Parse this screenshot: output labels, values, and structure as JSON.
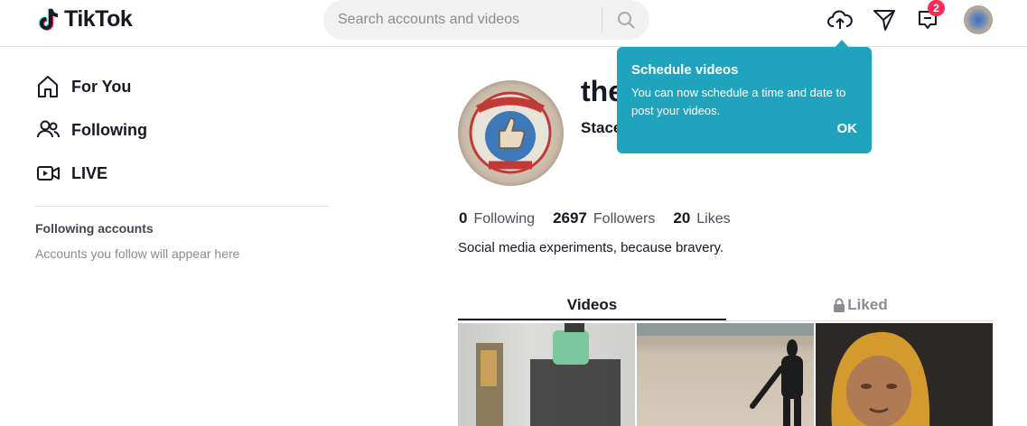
{
  "header": {
    "logo_text": "TikTok",
    "search_placeholder": "Search accounts and videos",
    "inbox_badge": "2",
    "icons": [
      "upload-icon",
      "messages-icon",
      "inbox-icon",
      "search-icon"
    ]
  },
  "sidebar": {
    "items": [
      {
        "label": "For You",
        "icon": "home-icon"
      },
      {
        "label": "Following",
        "icon": "users-icon"
      },
      {
        "label": "LIVE",
        "icon": "live-icon"
      }
    ],
    "following_heading": "Following accounts",
    "following_hint": "Accounts you follow will appear here"
  },
  "profile": {
    "username": "the",
    "nickname": "Stace",
    "stats": [
      {
        "value": "0",
        "label": "Following"
      },
      {
        "value": "2697",
        "label": "Followers"
      },
      {
        "value": "20",
        "label": "Likes"
      }
    ],
    "bio": "Social media experiments, because bravery."
  },
  "tabs": {
    "videos": "Videos",
    "liked": "Liked"
  },
  "tooltip": {
    "title": "Schedule videos",
    "body": "You can now schedule a time and date to post your videos.",
    "ok": "OK"
  },
  "colors": {
    "accent": "#fe2c55",
    "tooltip_bg": "#20a4bd",
    "text": "#161823"
  }
}
